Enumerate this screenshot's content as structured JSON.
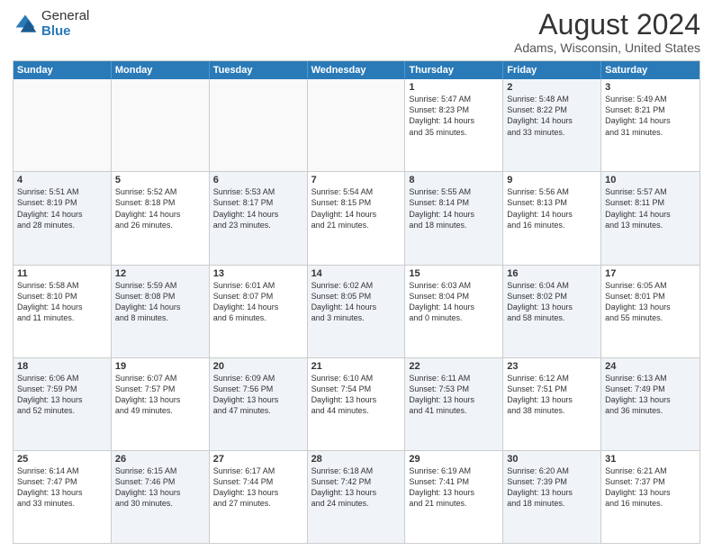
{
  "logo": {
    "general": "General",
    "blue": "Blue"
  },
  "header": {
    "month": "August 2024",
    "location": "Adams, Wisconsin, United States"
  },
  "days": [
    "Sunday",
    "Monday",
    "Tuesday",
    "Wednesday",
    "Thursday",
    "Friday",
    "Saturday"
  ],
  "rows": [
    [
      {
        "day": "",
        "text": "",
        "empty": true
      },
      {
        "day": "",
        "text": "",
        "empty": true
      },
      {
        "day": "",
        "text": "",
        "empty": true
      },
      {
        "day": "",
        "text": "",
        "empty": true
      },
      {
        "day": "1",
        "text": "Sunrise: 5:47 AM\nSunset: 8:23 PM\nDaylight: 14 hours\nand 35 minutes.",
        "empty": false,
        "shaded": false
      },
      {
        "day": "2",
        "text": "Sunrise: 5:48 AM\nSunset: 8:22 PM\nDaylight: 14 hours\nand 33 minutes.",
        "empty": false,
        "shaded": true
      },
      {
        "day": "3",
        "text": "Sunrise: 5:49 AM\nSunset: 8:21 PM\nDaylight: 14 hours\nand 31 minutes.",
        "empty": false,
        "shaded": false
      }
    ],
    [
      {
        "day": "4",
        "text": "Sunrise: 5:51 AM\nSunset: 8:19 PM\nDaylight: 14 hours\nand 28 minutes.",
        "empty": false,
        "shaded": true
      },
      {
        "day": "5",
        "text": "Sunrise: 5:52 AM\nSunset: 8:18 PM\nDaylight: 14 hours\nand 26 minutes.",
        "empty": false,
        "shaded": false
      },
      {
        "day": "6",
        "text": "Sunrise: 5:53 AM\nSunset: 8:17 PM\nDaylight: 14 hours\nand 23 minutes.",
        "empty": false,
        "shaded": true
      },
      {
        "day": "7",
        "text": "Sunrise: 5:54 AM\nSunset: 8:15 PM\nDaylight: 14 hours\nand 21 minutes.",
        "empty": false,
        "shaded": false
      },
      {
        "day": "8",
        "text": "Sunrise: 5:55 AM\nSunset: 8:14 PM\nDaylight: 14 hours\nand 18 minutes.",
        "empty": false,
        "shaded": true
      },
      {
        "day": "9",
        "text": "Sunrise: 5:56 AM\nSunset: 8:13 PM\nDaylight: 14 hours\nand 16 minutes.",
        "empty": false,
        "shaded": false
      },
      {
        "day": "10",
        "text": "Sunrise: 5:57 AM\nSunset: 8:11 PM\nDaylight: 14 hours\nand 13 minutes.",
        "empty": false,
        "shaded": true
      }
    ],
    [
      {
        "day": "11",
        "text": "Sunrise: 5:58 AM\nSunset: 8:10 PM\nDaylight: 14 hours\nand 11 minutes.",
        "empty": false,
        "shaded": false
      },
      {
        "day": "12",
        "text": "Sunrise: 5:59 AM\nSunset: 8:08 PM\nDaylight: 14 hours\nand 8 minutes.",
        "empty": false,
        "shaded": true
      },
      {
        "day": "13",
        "text": "Sunrise: 6:01 AM\nSunset: 8:07 PM\nDaylight: 14 hours\nand 6 minutes.",
        "empty": false,
        "shaded": false
      },
      {
        "day": "14",
        "text": "Sunrise: 6:02 AM\nSunset: 8:05 PM\nDaylight: 14 hours\nand 3 minutes.",
        "empty": false,
        "shaded": true
      },
      {
        "day": "15",
        "text": "Sunrise: 6:03 AM\nSunset: 8:04 PM\nDaylight: 14 hours\nand 0 minutes.",
        "empty": false,
        "shaded": false
      },
      {
        "day": "16",
        "text": "Sunrise: 6:04 AM\nSunset: 8:02 PM\nDaylight: 13 hours\nand 58 minutes.",
        "empty": false,
        "shaded": true
      },
      {
        "day": "17",
        "text": "Sunrise: 6:05 AM\nSunset: 8:01 PM\nDaylight: 13 hours\nand 55 minutes.",
        "empty": false,
        "shaded": false
      }
    ],
    [
      {
        "day": "18",
        "text": "Sunrise: 6:06 AM\nSunset: 7:59 PM\nDaylight: 13 hours\nand 52 minutes.",
        "empty": false,
        "shaded": true
      },
      {
        "day": "19",
        "text": "Sunrise: 6:07 AM\nSunset: 7:57 PM\nDaylight: 13 hours\nand 49 minutes.",
        "empty": false,
        "shaded": false
      },
      {
        "day": "20",
        "text": "Sunrise: 6:09 AM\nSunset: 7:56 PM\nDaylight: 13 hours\nand 47 minutes.",
        "empty": false,
        "shaded": true
      },
      {
        "day": "21",
        "text": "Sunrise: 6:10 AM\nSunset: 7:54 PM\nDaylight: 13 hours\nand 44 minutes.",
        "empty": false,
        "shaded": false
      },
      {
        "day": "22",
        "text": "Sunrise: 6:11 AM\nSunset: 7:53 PM\nDaylight: 13 hours\nand 41 minutes.",
        "empty": false,
        "shaded": true
      },
      {
        "day": "23",
        "text": "Sunrise: 6:12 AM\nSunset: 7:51 PM\nDaylight: 13 hours\nand 38 minutes.",
        "empty": false,
        "shaded": false
      },
      {
        "day": "24",
        "text": "Sunrise: 6:13 AM\nSunset: 7:49 PM\nDaylight: 13 hours\nand 36 minutes.",
        "empty": false,
        "shaded": true
      }
    ],
    [
      {
        "day": "25",
        "text": "Sunrise: 6:14 AM\nSunset: 7:47 PM\nDaylight: 13 hours\nand 33 minutes.",
        "empty": false,
        "shaded": false
      },
      {
        "day": "26",
        "text": "Sunrise: 6:15 AM\nSunset: 7:46 PM\nDaylight: 13 hours\nand 30 minutes.",
        "empty": false,
        "shaded": true
      },
      {
        "day": "27",
        "text": "Sunrise: 6:17 AM\nSunset: 7:44 PM\nDaylight: 13 hours\nand 27 minutes.",
        "empty": false,
        "shaded": false
      },
      {
        "day": "28",
        "text": "Sunrise: 6:18 AM\nSunset: 7:42 PM\nDaylight: 13 hours\nand 24 minutes.",
        "empty": false,
        "shaded": true
      },
      {
        "day": "29",
        "text": "Sunrise: 6:19 AM\nSunset: 7:41 PM\nDaylight: 13 hours\nand 21 minutes.",
        "empty": false,
        "shaded": false
      },
      {
        "day": "30",
        "text": "Sunrise: 6:20 AM\nSunset: 7:39 PM\nDaylight: 13 hours\nand 18 minutes.",
        "empty": false,
        "shaded": true
      },
      {
        "day": "31",
        "text": "Sunrise: 6:21 AM\nSunset: 7:37 PM\nDaylight: 13 hours\nand 16 minutes.",
        "empty": false,
        "shaded": false
      }
    ]
  ]
}
